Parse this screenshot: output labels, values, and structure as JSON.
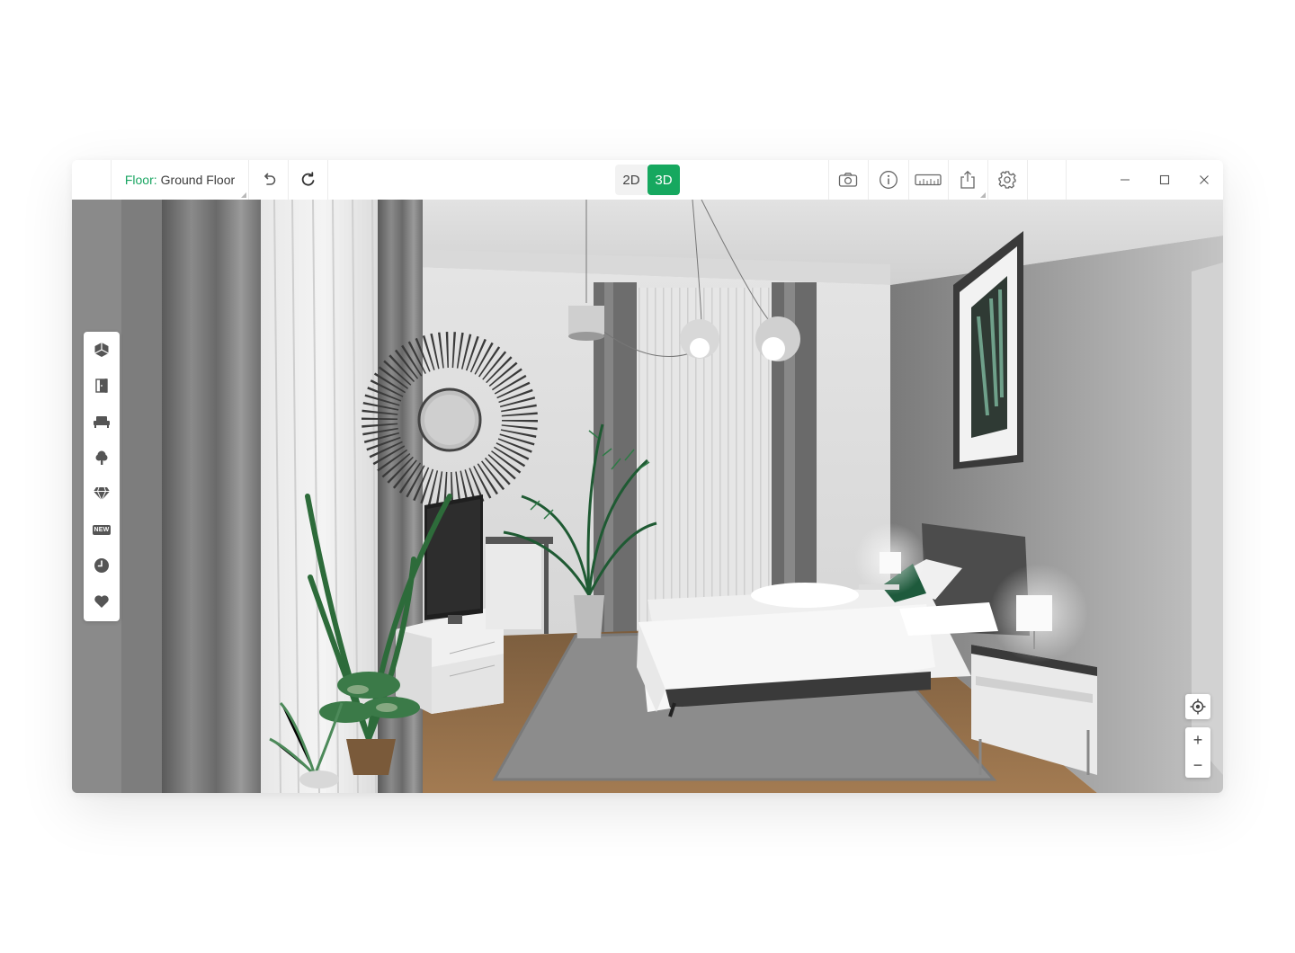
{
  "toolbar": {
    "floor_label": "Floor:",
    "floor_value": "Ground Floor",
    "view_2d_label": "2D",
    "view_3d_label": "3D",
    "active_view": "3D",
    "icons": [
      "undo-icon",
      "redo-icon",
      "camera-icon",
      "info-icon",
      "ruler-icon",
      "share-icon",
      "gear-icon"
    ]
  },
  "window_controls": [
    "minimize-icon",
    "maximize-icon",
    "close-icon"
  ],
  "left_toolbar": {
    "items": [
      "building-icon",
      "door-icon",
      "furniture-icon",
      "tree-icon",
      "diamond-icon",
      "new-icon",
      "recent-icon",
      "favorites-icon"
    ],
    "new_badge": "NEW"
  },
  "view_controls": {
    "zoom_in_label": "+",
    "zoom_out_label": "−",
    "icons": [
      "locate-icon"
    ]
  },
  "colors": {
    "accent": "#16a85f",
    "floor_label": "#1aa562",
    "toolbar_icon": "#555555"
  }
}
